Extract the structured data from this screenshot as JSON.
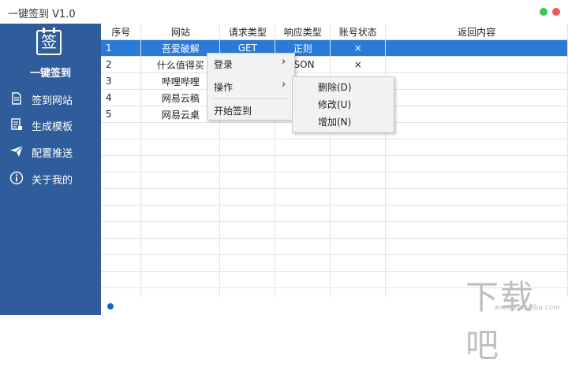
{
  "app": {
    "title": "一键签到 V1.0"
  },
  "sidebar": {
    "logo_glyph": "签",
    "logo_name": "一键签到",
    "items": [
      {
        "label": "签到网站",
        "icon": "document-icon"
      },
      {
        "label": "生成模板",
        "icon": "template-icon"
      },
      {
        "label": "配置推送",
        "icon": "send-icon"
      },
      {
        "label": "关于我的",
        "icon": "info-icon"
      }
    ]
  },
  "grid": {
    "columns": [
      "序号",
      "网站",
      "请求类型",
      "响应类型",
      "账号状态",
      "返回内容"
    ],
    "rows": [
      [
        "1",
        "吾爱破解",
        "GET",
        "正则",
        "×",
        ""
      ],
      [
        "2",
        "什么值得买",
        "",
        "JSON",
        "×",
        ""
      ],
      [
        "3",
        "哔哩哔哩",
        "",
        "",
        "",
        ""
      ],
      [
        "4",
        "网易云稿",
        "",
        "",
        "",
        ""
      ],
      [
        "5",
        "网易云桌",
        "",
        "",
        "",
        ""
      ]
    ],
    "selected_row": 1
  },
  "context_menu": {
    "items": [
      {
        "label": "登录",
        "has_submenu": true
      },
      {
        "label": "操作",
        "has_submenu": true
      },
      {
        "label": "开始签到",
        "has_submenu": false
      }
    ],
    "arrow": "›"
  },
  "submenu": {
    "items": [
      {
        "label": "删除(D)"
      },
      {
        "label": "修改(U)"
      },
      {
        "label": "增加(N)"
      }
    ]
  },
  "watermark": {
    "text": "下载吧",
    "url": "www.xiazaiba.com"
  },
  "colors": {
    "sidebar_bg": "#2f5c9b",
    "selection": "#2a7ad7",
    "close_dot": "#f05a57",
    "min_dot": "#3cc552",
    "status_dot": "#1565c0"
  }
}
